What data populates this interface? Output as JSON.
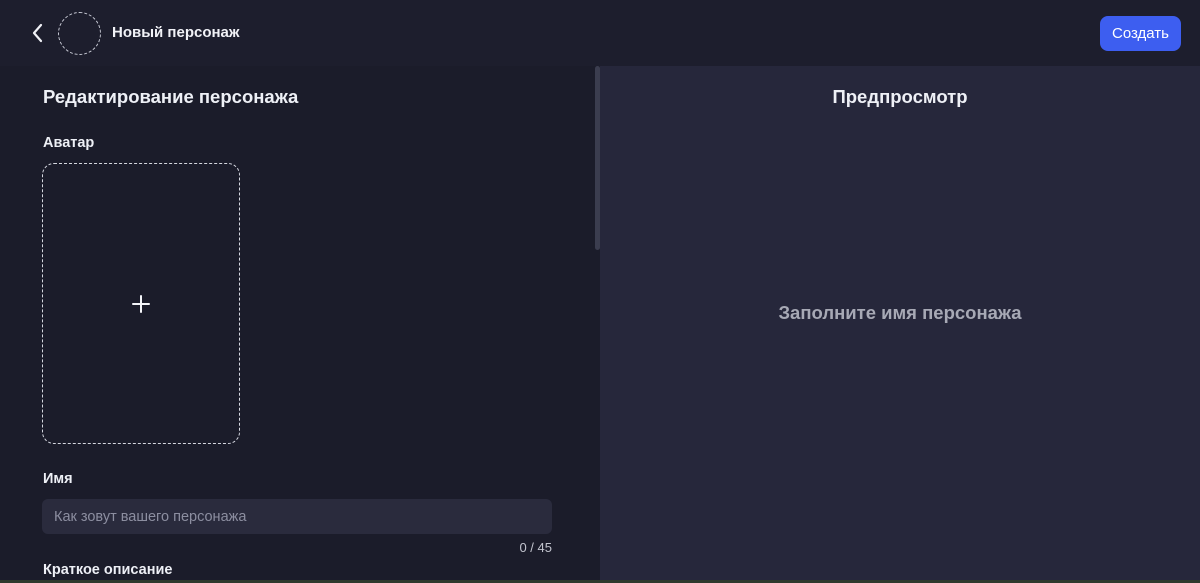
{
  "header": {
    "title": "Новый персонаж",
    "create_label": "Создать",
    "back_icon": "chevron-left-icon",
    "accent_color": "#3d5ef0"
  },
  "editor": {
    "section_title": "Редактирование персонажа",
    "avatar_label": "Аватар",
    "avatar_add_icon": "plus-icon",
    "name_label": "Имя",
    "name_value": "",
    "name_placeholder": "Как зовут вашего персонажа",
    "name_counter": "0 / 45",
    "short_description_label": "Краткое описание"
  },
  "preview": {
    "title": "Предпросмотр",
    "empty_message": "Заполните имя персонажа"
  }
}
